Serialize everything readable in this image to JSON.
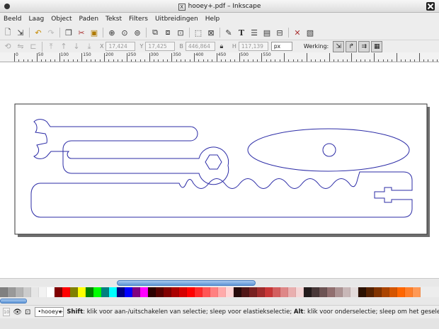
{
  "window": {
    "title": "hooey+.pdf – Inkscape",
    "app_icon_glyph": "X"
  },
  "menubar": {
    "items": [
      "Beeld",
      "Laag",
      "Object",
      "Paden",
      "Tekst",
      "Filters",
      "Uitbreidingen",
      "Help"
    ]
  },
  "toolbar": {
    "icons": [
      "new-document-icon",
      "open-document-icon",
      "undo-icon",
      "redo-icon",
      "copy-icon",
      "cut-icon",
      "paste-icon",
      "zoom-selection-icon",
      "zoom-drawing-icon",
      "zoom-page-icon",
      "duplicate-icon",
      "clone-icon",
      "unlink-clone-icon",
      "group-icon",
      "ungroup-icon",
      "fill-stroke-icon",
      "text-font-icon",
      "layers-icon",
      "xml-editor-icon",
      "align-distribute-icon",
      "preferences-icon",
      "document-properties-icon"
    ]
  },
  "controls": {
    "x_label": "X",
    "x_value": "17,424",
    "y_label": "Y",
    "y_value": "17,425",
    "w_label": "B",
    "w_value": "446,864",
    "h_label": "H",
    "h_value": "117,139",
    "unit": "px",
    "working_label": "Werking:"
  },
  "ruler": {
    "labels": [
      "0",
      "50",
      "100",
      "150",
      "200",
      "250",
      "300",
      "350",
      "400",
      "450",
      "500",
      "550"
    ]
  },
  "palette": {
    "colors": [
      "#808080",
      "#999999",
      "#b3b3b3",
      "#cccccc",
      "#e6e6e6",
      "#f2f2f2",
      "#ffffff",
      "#800000",
      "#ff0000",
      "#808000",
      "#ffff00",
      "#008000",
      "#00ff00",
      "#008080",
      "#00ffff",
      "#000080",
      "#0000ff",
      "#800080",
      "#ff00ff",
      "#2b0000",
      "#550000",
      "#800000",
      "#aa0000",
      "#d40000",
      "#ff0000",
      "#ff2a2a",
      "#ff5555",
      "#ff8080",
      "#ffaaaa",
      "#ffd5d5",
      "#280b0b",
      "#501616",
      "#782121",
      "#a02c2c",
      "#c83737",
      "#d35f5f",
      "#de8787",
      "#e9afaf",
      "#f4d7d7",
      "#241c1c",
      "#483737",
      "#6c5353",
      "#916f6f",
      "#ac9393",
      "#c8b7b7",
      "#e3dbdb",
      "#2b1100",
      "#552200",
      "#803300",
      "#aa4400",
      "#d45500",
      "#ff6600",
      "#ff7f2a",
      "#ff9955"
    ]
  },
  "statusbar": {
    "zoom": "10",
    "layer": "•hooey+",
    "msg_shift_key": "Shift",
    "msg_shift_text": ": klik voor aan-/uitschakelen van selectie; sleep voor elastiekselectie; ",
    "msg_alt_key": "Alt",
    "msg_alt_text": ": klik voor onderselectie; sleep om het gesele..."
  },
  "colors": {
    "path_stroke": "#2b2ba6",
    "scroll_thumb": "#5d95d6"
  }
}
